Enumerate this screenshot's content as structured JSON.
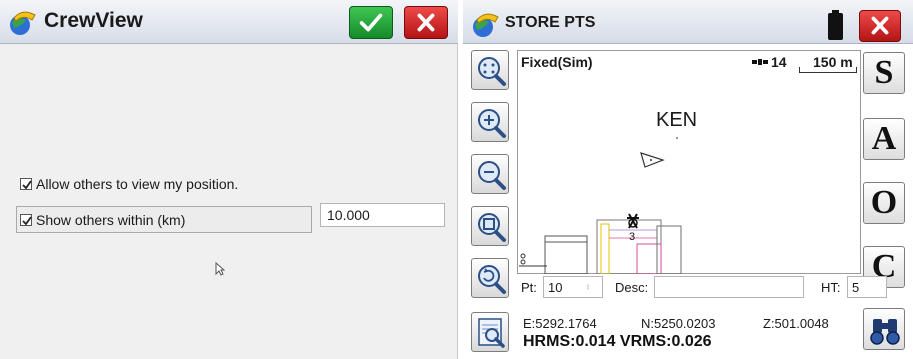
{
  "crewview": {
    "title": "CrewView",
    "ok_icon": "checkmark-icon",
    "close_icon": "close-icon",
    "allow_label": "Allow others to view my position.",
    "allow_checked": true,
    "show_label": "Show others within (km)",
    "show_checked": true,
    "distance_value": "10.000"
  },
  "store": {
    "title": "STORE PTS",
    "battery_icon": "battery-icon",
    "close_icon": "close-icon",
    "fix_status": "Fixed(Sim)",
    "satellites": "14",
    "scale": "150 m",
    "map_label": "KEN",
    "tools": [
      "zoom-extents-icon",
      "zoom-in-icon",
      "zoom-out-icon",
      "zoom-window-icon",
      "zoom-previous-icon",
      "map-search-icon"
    ],
    "side_buttons": [
      "S",
      "A",
      "O",
      "C"
    ],
    "binoculars_icon": "binoculars-icon",
    "pt_label": "Pt:",
    "pt_value": "10",
    "desc_label": "Desc:",
    "desc_value": "",
    "ht_label": "HT:",
    "ht_value": "5",
    "easting": "E:5292.1764",
    "northing": "N:5250.0203",
    "elevation": "Z:501.0048",
    "rms": "HRMS:0.014 VRMS:0.026"
  },
  "colors": {
    "ok_green": "#1f9b33",
    "close_red": "#d12020",
    "titlebar": "#d7dde8"
  }
}
